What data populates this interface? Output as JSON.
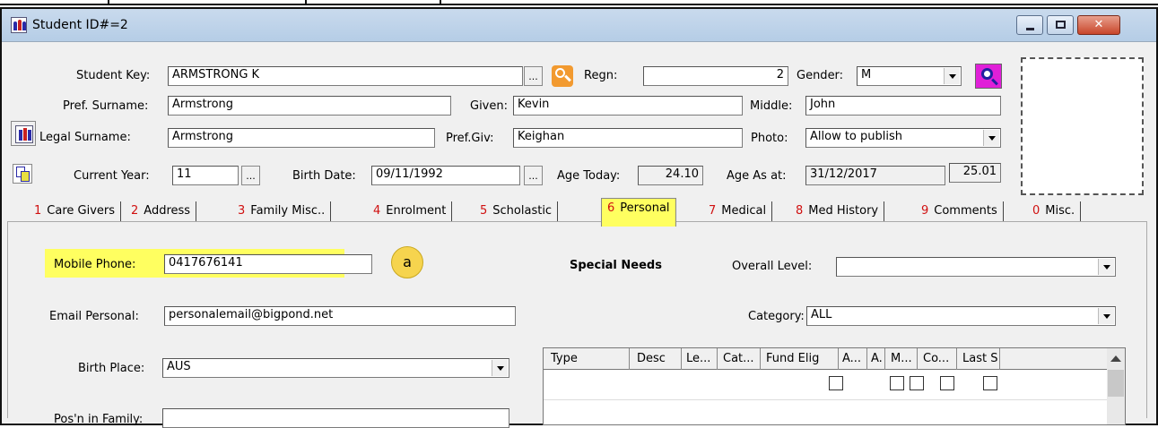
{
  "window": {
    "title": "Student ID#=2"
  },
  "header": {
    "student_key_label": "Student Key:",
    "student_key": "ARMSTRONG K",
    "regn_label": "Regn:",
    "regn": "2",
    "gender_label": "Gender:",
    "gender": "M",
    "pref_surname_label": "Pref. Surname:",
    "pref_surname": "Armstrong",
    "given_label": "Given:",
    "given": "Kevin",
    "middle_label": "Middle:",
    "middle": "John",
    "legal_surname_label": "Legal Surname:",
    "legal_surname": "Armstrong",
    "pref_giv_label": "Pref.Giv:",
    "pref_giv": "Keighan",
    "photo_label": "Photo:",
    "photo": "Allow to publish",
    "current_year_label": "Current Year:",
    "current_year": "11",
    "birth_date_label": "Birth Date:",
    "birth_date": "09/11/1992",
    "age_today_label": "Age Today:",
    "age_today": "24.10",
    "age_as_at_label": "Age As at:",
    "age_as_at": "31/12/2017",
    "age_as_at_value": "25.01",
    "ellipsis": "..."
  },
  "tabs": [
    {
      "num": "1",
      "label": "Care Givers"
    },
    {
      "num": "2",
      "label": "Address"
    },
    {
      "num": "3",
      "label": "Family Misc.."
    },
    {
      "num": "4",
      "label": "Enrolment"
    },
    {
      "num": "5",
      "label": "Scholastic"
    },
    {
      "num": "6",
      "label": "Personal"
    },
    {
      "num": "7",
      "label": "Medical"
    },
    {
      "num": "8",
      "label": "Med History"
    },
    {
      "num": "9",
      "label": "Comments"
    },
    {
      "num": "0",
      "label": "Misc."
    }
  ],
  "personal": {
    "mobile_label": "Mobile Phone:",
    "mobile": "0417676141",
    "badge": "a",
    "email_label": "Email Personal:",
    "email": "personalemail@bigpond.net",
    "birth_place_label": "Birth Place:",
    "birth_place": "AUS",
    "posn_label": "Pos'n in Family:",
    "special_needs": "Special Needs",
    "overall_level_label": "Overall Level:",
    "overall_level": "",
    "category_label": "Category:",
    "category": "ALL"
  },
  "grid": {
    "columns": [
      "Type",
      "Desc",
      "Le...",
      "Cat...",
      "Fund Elig",
      "A...",
      "A.",
      "M...",
      "Co...",
      "Last S"
    ]
  },
  "colors": {
    "highlight": "#ffff60",
    "tab_number": "#d01010",
    "badge": "#f6d44e"
  }
}
